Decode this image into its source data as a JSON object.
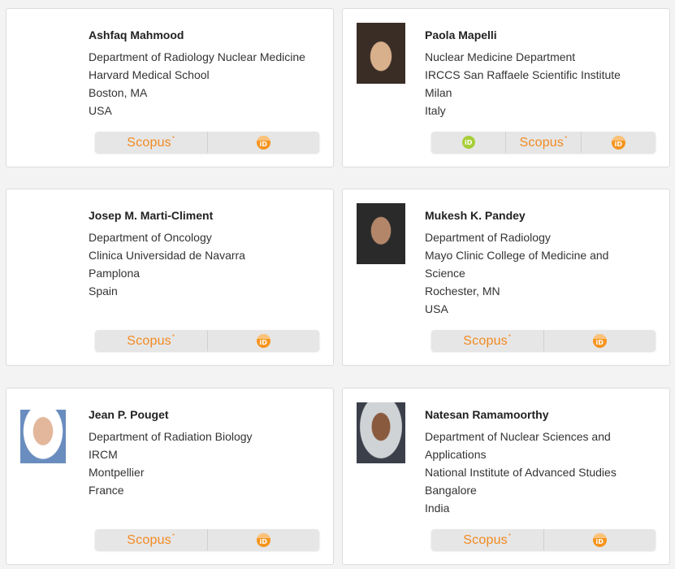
{
  "brand": {
    "scopus_color": "#f28a22",
    "orcid_color": "#a6ce39",
    "id_color": "#f5951e"
  },
  "people": [
    {
      "name": "Ashfaq Mahmood",
      "lines": [
        "Department of Radiology Nuclear Medicine",
        "Harvard Medical School",
        "Boston, MA",
        "USA"
      ],
      "buttons": [
        {
          "type": "scopus",
          "label": "Scopus"
        },
        {
          "type": "id-icon",
          "label": "iD"
        }
      ]
    },
    {
      "name": "Paola Mapelli",
      "lines": [
        "Nuclear Medicine Department",
        "IRCCS San Raffaele Scientific Institute",
        "Milan",
        "Italy"
      ],
      "buttons": [
        {
          "type": "orcid-icon",
          "label": "iD"
        },
        {
          "type": "scopus",
          "label": "Scopus"
        },
        {
          "type": "id-icon",
          "label": "iD"
        }
      ]
    },
    {
      "name": "Josep M. Marti-Climent",
      "lines": [
        "Department of Oncology",
        "Clinica Universidad de Navarra",
        "Pamplona",
        "Spain"
      ],
      "buttons": [
        {
          "type": "scopus",
          "label": "Scopus"
        },
        {
          "type": "id-icon",
          "label": "iD"
        }
      ]
    },
    {
      "name": "Mukesh K. Pandey",
      "lines": [
        "Department of Radiology",
        "Mayo Clinic College of Medicine and",
        "Science",
        "Rochester, MN",
        "USA"
      ],
      "buttons": [
        {
          "type": "scopus",
          "label": "Scopus"
        },
        {
          "type": "id-icon",
          "label": "iD"
        }
      ]
    },
    {
      "name": "Jean P. Pouget",
      "lines": [
        "Department of Radiation Biology",
        "IRCM",
        "Montpellier",
        "France"
      ],
      "buttons": [
        {
          "type": "scopus",
          "label": "Scopus"
        },
        {
          "type": "id-icon",
          "label": "iD"
        }
      ]
    },
    {
      "name": "Natesan Ramamoorthy",
      "lines": [
        "Department of Nuclear Sciences and",
        "Applications",
        "National Institute of Advanced Studies",
        "Bangalore",
        "India"
      ],
      "buttons": [
        {
          "type": "scopus",
          "label": "Scopus"
        },
        {
          "type": "id-icon",
          "label": "iD"
        }
      ]
    }
  ]
}
